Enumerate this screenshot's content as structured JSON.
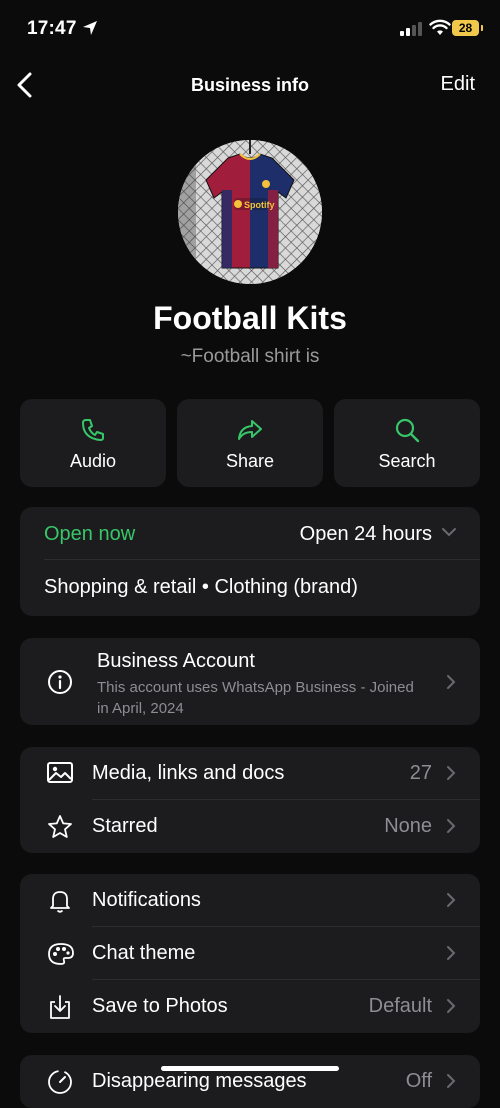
{
  "status": {
    "time": "17:47",
    "battery": "28"
  },
  "nav": {
    "title": "Business info",
    "edit": "Edit"
  },
  "profile": {
    "name": "Football Kits",
    "subtitle": "~Football shirt is",
    "jersey_sponsor": "Spotify"
  },
  "actions": [
    {
      "label": "Audio",
      "icon": "phone-icon"
    },
    {
      "label": "Share",
      "icon": "share-icon"
    },
    {
      "label": "Search",
      "icon": "search-icon"
    }
  ],
  "hours": {
    "status": "Open now",
    "hours": "Open 24 hours",
    "category": "Shopping & retail • Clothing (brand)"
  },
  "business": {
    "title": "Business Account",
    "desc": "This account uses WhatsApp Business - Joined in April, 2024"
  },
  "media": {
    "label": "Media, links and docs",
    "count": "27"
  },
  "starred": {
    "label": "Starred",
    "value": "None"
  },
  "notifications": {
    "label": "Notifications"
  },
  "chat_theme": {
    "label": "Chat theme"
  },
  "save_photos": {
    "label": "Save to Photos",
    "value": "Default"
  },
  "disappearing": {
    "label": "Disappearing messages",
    "value": "Off"
  },
  "colors": {
    "accent": "#38c768",
    "card": "#1c1c1e",
    "background": "#0b0b0b"
  }
}
